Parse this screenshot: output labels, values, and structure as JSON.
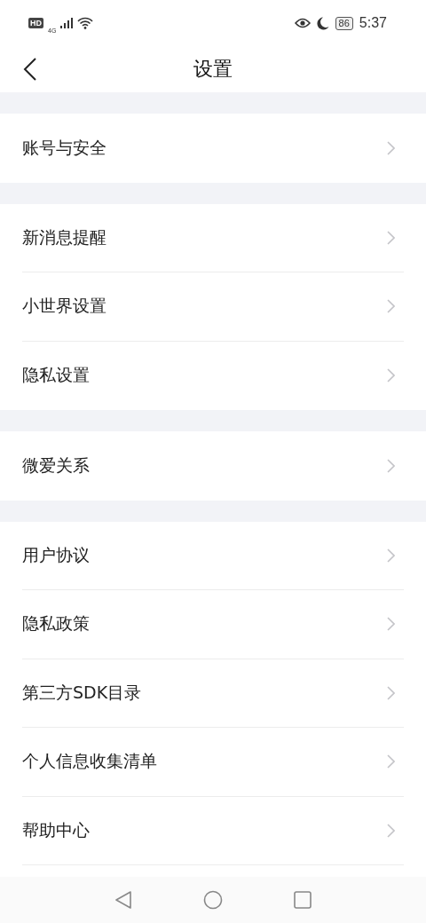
{
  "status_bar": {
    "hd": "HD",
    "network": "4G",
    "battery": "86",
    "time": "5:37"
  },
  "header": {
    "title": "设置"
  },
  "groups": [
    {
      "items": [
        {
          "label": "账号与安全"
        }
      ]
    },
    {
      "items": [
        {
          "label": "新消息提醒"
        },
        {
          "label": "小世界设置"
        },
        {
          "label": "隐私设置"
        }
      ]
    },
    {
      "items": [
        {
          "label": "微爱关系"
        }
      ]
    },
    {
      "items": [
        {
          "label": "用户协议"
        },
        {
          "label": "隐私政策"
        },
        {
          "label": "第三方SDK目录"
        },
        {
          "label": "个人信息收集清单"
        },
        {
          "label": "帮助中心"
        }
      ]
    }
  ]
}
